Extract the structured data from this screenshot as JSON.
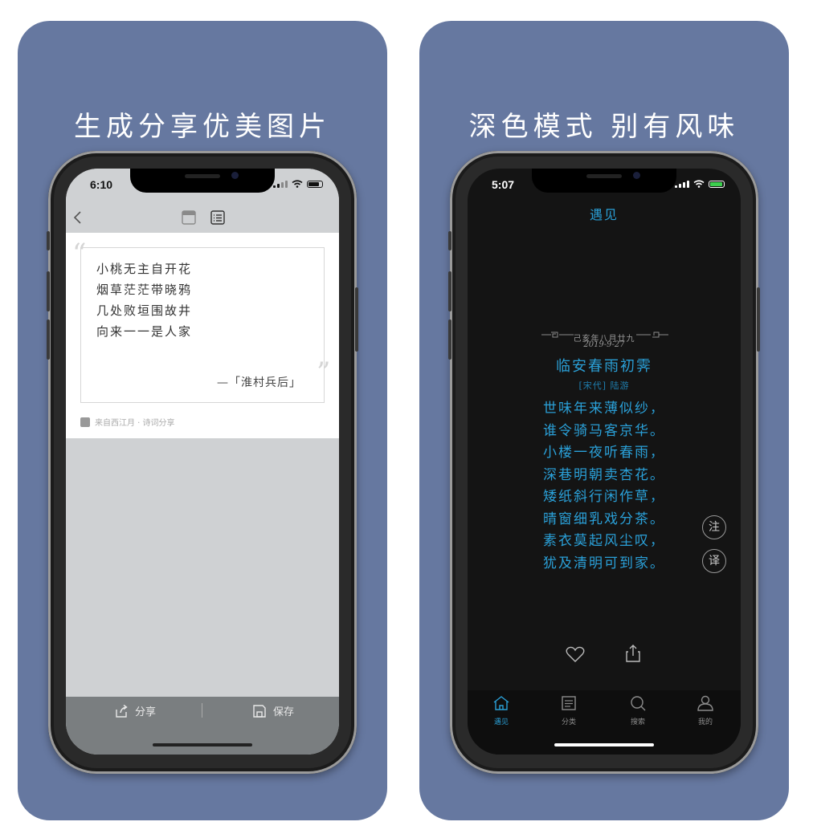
{
  "left_panel": {
    "headline": "生成分享优美图片",
    "status_time": "6:10",
    "poem_lines": [
      "小桃无主自开花",
      "烟草茫茫带晓鸦",
      "几处败垣围故井",
      "向来一一是人家"
    ],
    "attribution": "—「淮村兵后」",
    "source_note": "来自西江月 · 诗词分享",
    "share_label": "分享",
    "save_label": "保存"
  },
  "right_panel": {
    "headline": "深色模式 别有风味",
    "status_time": "5:07",
    "nav_title": "遇见",
    "lunar_date": "己亥年八月廿九",
    "date": "2019-9-27",
    "poem_title": "临安春雨初霁",
    "author": "[宋代] 陆游",
    "poem_lines": [
      "世味年来薄似纱，",
      "谁令骑马客京华。",
      "小楼一夜听春雨，",
      "深巷明朝卖杏花。",
      "矮纸斜行闲作草，",
      "晴窗细乳戏分茶。",
      "素衣莫起风尘叹，",
      "犹及清明可到家。"
    ],
    "note_button": "注",
    "translate_button": "译",
    "tabs": [
      {
        "label": "遇见"
      },
      {
        "label": "分类"
      },
      {
        "label": "搜索"
      },
      {
        "label": "我的"
      }
    ]
  },
  "colors": {
    "panel_bg": "#6678a0",
    "accent_blue": "#2a9fd6",
    "dark_bg": "#141414",
    "light_gray": "#cfd1d3"
  }
}
